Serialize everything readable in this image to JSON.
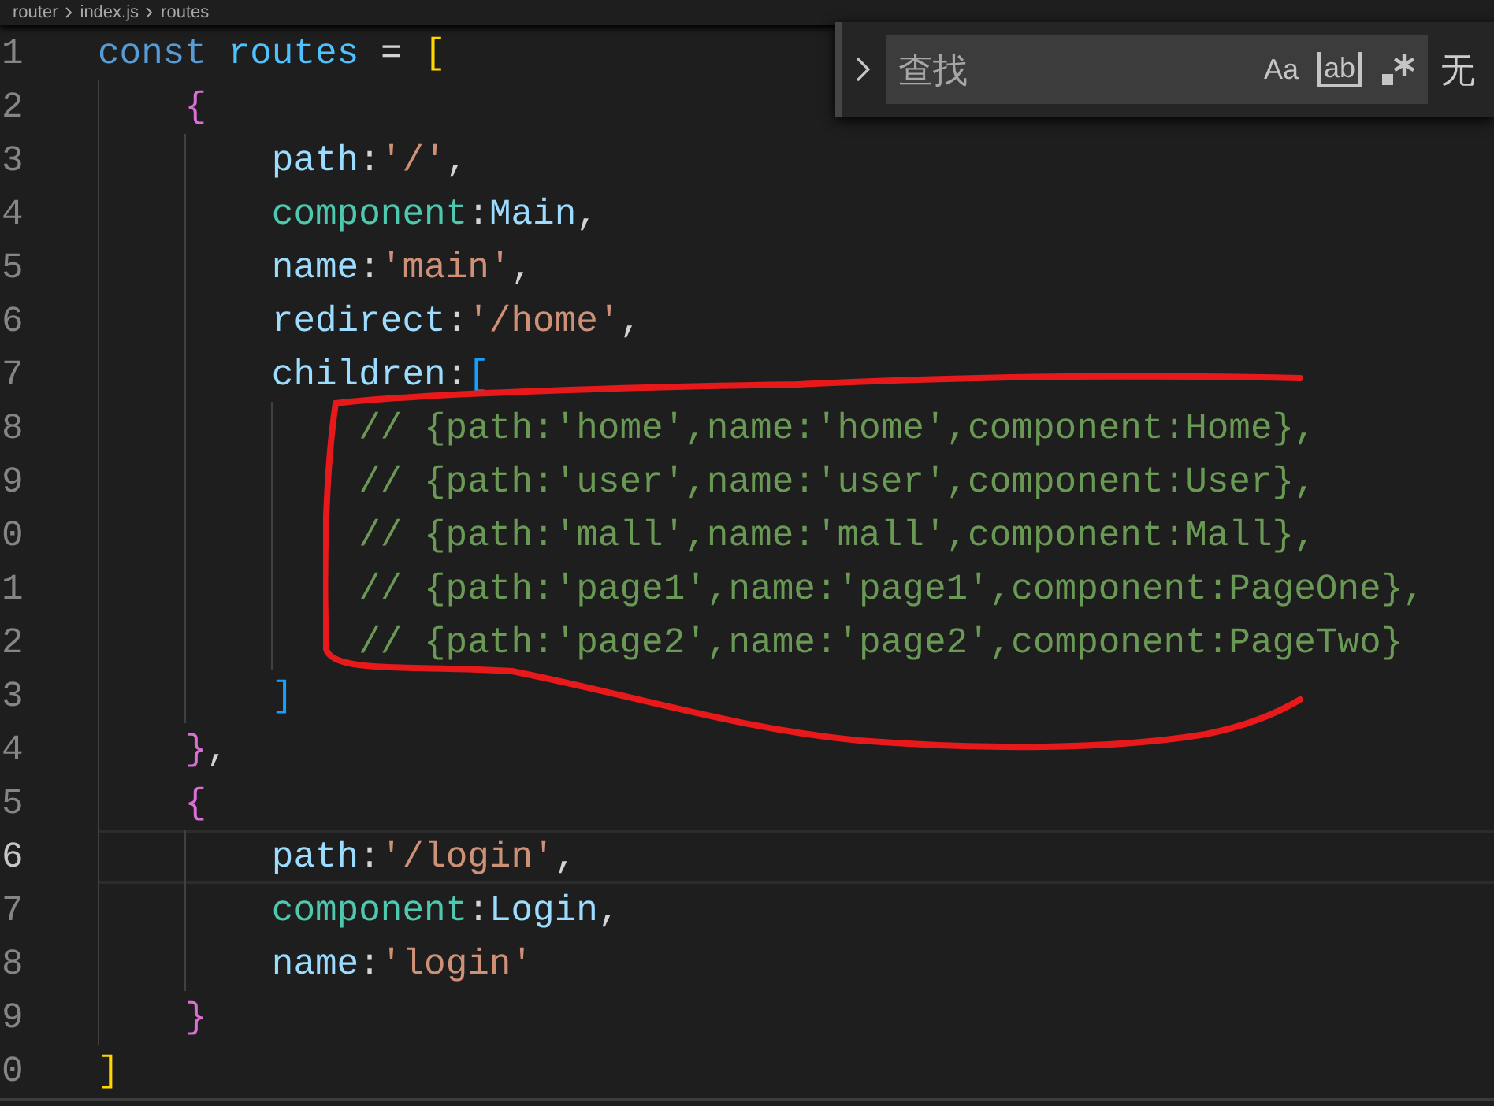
{
  "breadcrumb": [
    "router",
    "index.js",
    "routes"
  ],
  "find_widget": {
    "placeholder": "查找",
    "match_case": "Aa",
    "whole_word": "ab",
    "result": "无"
  },
  "code": [
    {
      "number": "1",
      "current": false,
      "tokens": [
        {
          "text": "const ",
          "kind": "keyword"
        },
        {
          "text": "routes",
          "kind": "variable"
        },
        {
          "text": " = ",
          "kind": "punct"
        },
        {
          "text": "[",
          "kind": "bracket1"
        }
      ],
      "children": [
        {
          "number": "2",
          "current": false,
          "tokens": [
            {
              "text": "{",
              "kind": "bracket2"
            }
          ],
          "children": [
            {
              "number": "3",
              "current": false,
              "tokens": [
                {
                  "text": "path",
                  "kind": "prop"
                },
                {
                  "text": ":",
                  "kind": "punct"
                },
                {
                  "text": "'/'",
                  "kind": "string"
                },
                {
                  "text": ",",
                  "kind": "punct"
                }
              ]
            },
            {
              "number": "4",
              "current": false,
              "tokens": [
                {
                  "text": "component",
                  "kind": "type"
                },
                {
                  "text": ":",
                  "kind": "punct"
                },
                {
                  "text": "Main",
                  "kind": "prop"
                },
                {
                  "text": ",",
                  "kind": "punct"
                }
              ]
            },
            {
              "number": "5",
              "current": false,
              "tokens": [
                {
                  "text": "name",
                  "kind": "prop"
                },
                {
                  "text": ":",
                  "kind": "punct"
                },
                {
                  "text": "'main'",
                  "kind": "string"
                },
                {
                  "text": ",",
                  "kind": "punct"
                }
              ]
            },
            {
              "number": "6",
              "current": false,
              "tokens": [
                {
                  "text": "redirect",
                  "kind": "prop"
                },
                {
                  "text": ":",
                  "kind": "punct"
                },
                {
                  "text": "'/home'",
                  "kind": "string"
                },
                {
                  "text": ",",
                  "kind": "punct"
                }
              ]
            },
            {
              "number": "7",
              "current": false,
              "tokens": [
                {
                  "text": "children",
                  "kind": "prop"
                },
                {
                  "text": ":",
                  "kind": "punct"
                },
                {
                  "text": "[",
                  "kind": "bracket3"
                }
              ],
              "children": [
                {
                  "number": "8",
                  "current": false,
                  "tokens": [
                    {
                      "text": "// {path:'home',name:'home',component:Home},",
                      "kind": "comment"
                    }
                  ]
                },
                {
                  "number": "9",
                  "current": false,
                  "tokens": [
                    {
                      "text": "// {path:'user',name:'user',component:User},",
                      "kind": "comment"
                    }
                  ]
                },
                {
                  "number": "0",
                  "current": false,
                  "tokens": [
                    {
                      "text": "// {path:'mall',name:'mall',component:Mall},",
                      "kind": "comment"
                    }
                  ]
                },
                {
                  "number": "1",
                  "current": false,
                  "tokens": [
                    {
                      "text": "// {path:'page1',name:'page1',component:PageOne},",
                      "kind": "comment"
                    }
                  ]
                },
                {
                  "number": "2",
                  "current": false,
                  "tokens": [
                    {
                      "text": "// {path:'page2',name:'page2',component:PageTwo}",
                      "kind": "comment"
                    }
                  ]
                }
              ]
            },
            {
              "number": "3",
              "current": false,
              "tokens": [
                {
                  "text": "]",
                  "kind": "bracket3"
                }
              ]
            }
          ]
        },
        {
          "number": "4",
          "current": false,
          "tokens": [
            {
              "text": "}",
              "kind": "bracket2"
            },
            {
              "text": ",",
              "kind": "punct"
            }
          ]
        },
        {
          "number": "5",
          "current": false,
          "tokens": [
            {
              "text": "{",
              "kind": "bracket2"
            }
          ],
          "children": [
            {
              "number": "6",
              "current": true,
              "tokens": [
                {
                  "text": "path",
                  "kind": "prop"
                },
                {
                  "text": ":",
                  "kind": "punct"
                },
                {
                  "text": "'/login'",
                  "kind": "string"
                },
                {
                  "text": ",",
                  "kind": "punct"
                }
              ]
            },
            {
              "number": "7",
              "current": false,
              "tokens": [
                {
                  "text": "component",
                  "kind": "type"
                },
                {
                  "text": ":",
                  "kind": "punct"
                },
                {
                  "text": "Login",
                  "kind": "prop"
                },
                {
                  "text": ",",
                  "kind": "punct"
                }
              ]
            },
            {
              "number": "8",
              "current": false,
              "tokens": [
                {
                  "text": "name",
                  "kind": "prop"
                },
                {
                  "text": ":",
                  "kind": "punct"
                },
                {
                  "text": "'login'",
                  "kind": "string"
                }
              ]
            }
          ]
        },
        {
          "number": "9",
          "current": false,
          "tokens": [
            {
              "text": "}",
              "kind": "bracket2"
            }
          ]
        }
      ]
    },
    {
      "number": "0",
      "current": false,
      "tokens": [
        {
          "text": "]",
          "kind": "bracket1"
        }
      ]
    }
  ]
}
